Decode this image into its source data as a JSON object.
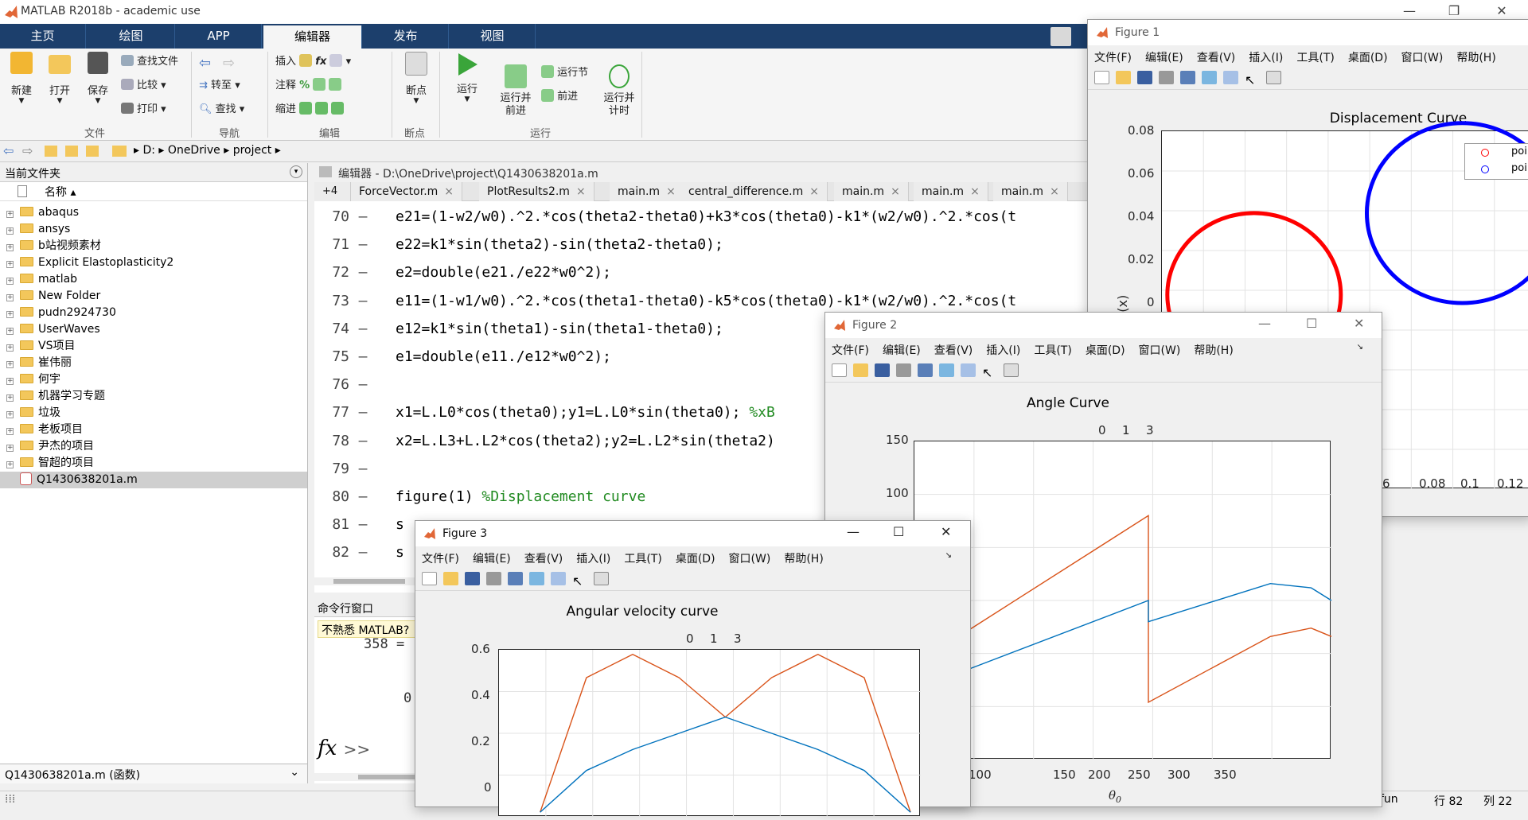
{
  "window": {
    "title": "MATLAB R2018b - academic use"
  },
  "ribbon_tabs": [
    "主页",
    "绘图",
    "APP",
    "编辑器",
    "发布",
    "视图"
  ],
  "ribbon": {
    "new": "新建",
    "open": "打开",
    "save": "保存",
    "find_files": "查找文件",
    "compare": "比较",
    "print": "打印",
    "goto": "转至",
    "find": "查找",
    "insert": "插入",
    "comment": "注释",
    "indent": "缩进",
    "breakpoints": "断点",
    "run": "运行",
    "run_advance": "运行并\n前进",
    "run_section": "运行节",
    "advance": "前进",
    "run_time": "运行并\n计时",
    "groups": [
      "文件",
      "导航",
      "编辑",
      "断点",
      "运行"
    ]
  },
  "address": {
    "drive": "D:",
    "parts": [
      "OneDrive",
      "project"
    ]
  },
  "current_folder": {
    "title": "当前文件夹",
    "col_name": "名称 ▴",
    "items": [
      "abaqus",
      "ansys",
      "b站视频素材",
      "Explicit Elastoplasticity2",
      "matlab",
      "New Folder",
      "pudn2924730",
      "UserWaves",
      "VS项目",
      "崔伟丽",
      "何宇",
      "机器学习专题",
      "垃圾",
      "老板项目",
      "尹杰的项目",
      "智超的项目"
    ],
    "selected_file": "Q1430638201a.m",
    "footer": "Q1430638201a.m  (函数)"
  },
  "editor": {
    "title": "编辑器 - D:\\OneDrive\\project\\Q1430638201a.m",
    "tab_overflow": "+4",
    "tabs": [
      "ForceVector.m",
      "PlotResults2.m",
      "main.m",
      "central_difference.m",
      "main.m",
      "main.m",
      "main.m"
    ],
    "lines": [
      {
        "n": "70",
        "code": "e21=(1-w2/w0).^2.*cos(theta2-theta0)+k3*cos(theta0)-k1*(w2/w0).^2.*cos(t",
        "comment": ""
      },
      {
        "n": "71",
        "code": "e22=k1*sin(theta2)-sin(theta2-theta0);",
        "comment": ""
      },
      {
        "n": "72",
        "code": "e2=double(e21./e22*w0^2);",
        "comment": ""
      },
      {
        "n": "73",
        "code": "e11=(1-w1/w0).^2.*cos(theta1-theta0)-k5*cos(theta0)-k1*(w2/w0).^2.*cos(t",
        "comment": ""
      },
      {
        "n": "74",
        "code": "e12=k1*sin(theta1)-sin(theta1-theta0);",
        "comment": ""
      },
      {
        "n": "75",
        "code": "e1=double(e11./e12*w0^2);",
        "comment": ""
      },
      {
        "n": "76",
        "code": "",
        "comment": ""
      },
      {
        "n": "77",
        "code": "x1=L.L0*cos(theta0);y1=L.L0*sin(theta0); ",
        "comment": "%xB"
      },
      {
        "n": "78",
        "code": "x2=L.L3+L.L2*cos(theta2);y2=L.L2*sin(theta2)",
        "comment": ""
      },
      {
        "n": "79",
        "code": "",
        "comment": ""
      },
      {
        "n": "80",
        "code": "figure(1) ",
        "comment": "%Displacement curve"
      },
      {
        "n": "81",
        "code": "s",
        "comment": ""
      },
      {
        "n": "82",
        "code": "s",
        "comment": ""
      }
    ]
  },
  "command_window": {
    "title": "命令行窗口",
    "hint": "不熟悉 MATLAB?",
    "output1": "358  =",
    "output2": "0",
    "prompt": "fx >>"
  },
  "status": {
    "fn": "fun",
    "row": "行  82",
    "col": "列  22"
  },
  "figures": {
    "menu": [
      "文件(F)",
      "编辑(E)",
      "查看(V)",
      "插入(I)",
      "工具(T)",
      "桌面(D)",
      "窗口(W)",
      "帮助(H)"
    ],
    "fig1": {
      "title": "Figure 1",
      "plot_title": "Displacement Curve",
      "ylabel": "y(x)",
      "legend": [
        "poi",
        "poi"
      ],
      "yticks": [
        "0.08",
        "0.06",
        "0.04",
        "0.02",
        "0"
      ],
      "xticks": [
        "6",
        "0.08",
        "0.1",
        "0.12"
      ]
    },
    "fig2": {
      "title": "Figure 2",
      "plot_title": "Angle Curve",
      "top_labels": [
        "0",
        "1",
        "3"
      ],
      "yticks": [
        "150",
        "100"
      ],
      "xticks": [
        "0",
        "100",
        "150",
        "200",
        "250",
        "300",
        "350"
      ],
      "xlabel": "θ",
      "xlabel_sub": "0"
    },
    "fig3": {
      "title": "Figure 3",
      "plot_title": "Angular velocity curve",
      "top_labels": [
        "0",
        "1",
        "3"
      ],
      "yticks": [
        "0.6",
        "0.4",
        "0.2",
        "0"
      ]
    }
  },
  "chart_data": [
    {
      "type": "scatter",
      "title": "Displacement Curve",
      "ylabel": "y(x)",
      "legend": [
        "poi",
        "poi"
      ],
      "ylim": [
        -0.01,
        0.08
      ],
      "series": [
        {
          "name": "poi",
          "color": "#ff0000",
          "shape": "circle",
          "center": [
            0.0,
            0.0
          ],
          "radius": 0.04
        },
        {
          "name": "poi",
          "color": "#0000ff",
          "shape": "circle",
          "center": [
            0.096,
            0.04
          ],
          "radius": 0.044
        }
      ]
    },
    {
      "type": "line",
      "title": "Angle Curve",
      "xlim": [
        0,
        360
      ],
      "xlabel": "θ0",
      "series": [
        {
          "color": "#d95319",
          "x": [
            0,
            180,
            180,
            300,
            340,
            360
          ],
          "y": [
            60,
            115,
            27,
            58,
            62,
            58
          ]
        },
        {
          "color": "#0072bd",
          "x": [
            0,
            180,
            180,
            300,
            340,
            360
          ],
          "y": [
            42,
            75,
            65,
            83,
            81,
            75
          ]
        }
      ]
    },
    {
      "type": "line",
      "title": "Angular velocity curve",
      "ylim": [
        -0.1,
        0.6
      ],
      "series": [
        {
          "color": "#d95319",
          "x": [
            0,
            45,
            90,
            135,
            180,
            225,
            270,
            315,
            360
          ],
          "y": [
            -0.1,
            0.48,
            0.58,
            0.48,
            0.31,
            0.48,
            0.58,
            0.48,
            -0.1
          ]
        },
        {
          "color": "#0072bd",
          "x": [
            0,
            45,
            90,
            135,
            180,
            225,
            270,
            315,
            360
          ],
          "y": [
            -0.1,
            0.08,
            0.17,
            0.24,
            0.31,
            0.24,
            0.17,
            0.08,
            -0.1
          ]
        }
      ]
    }
  ]
}
